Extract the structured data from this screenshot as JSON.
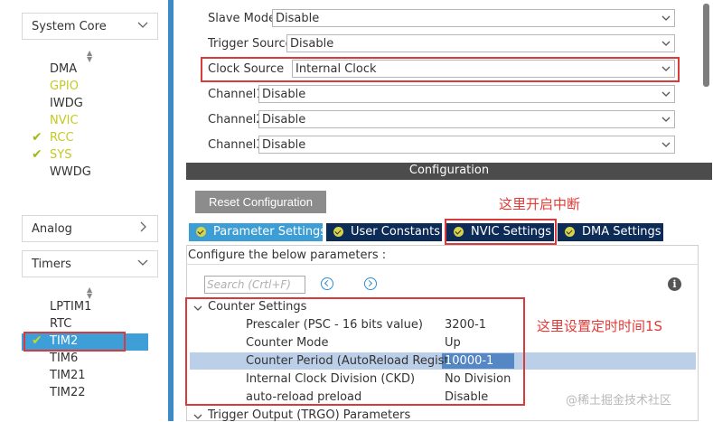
{
  "sidebar": {
    "categories": [
      {
        "label": "System Core",
        "expanded": true
      },
      {
        "label": "Analog",
        "expanded": false
      },
      {
        "label": "Timers",
        "expanded": true
      }
    ],
    "system_core_items": [
      {
        "label": "DMA",
        "state": "normal",
        "checked": false
      },
      {
        "label": "GPIO",
        "state": "yellow",
        "checked": false
      },
      {
        "label": "IWDG",
        "state": "normal",
        "checked": false
      },
      {
        "label": "NVIC",
        "state": "yellow",
        "checked": false
      },
      {
        "label": "RCC",
        "state": "yellow",
        "checked": true
      },
      {
        "label": "SYS",
        "state": "yellow",
        "checked": true
      },
      {
        "label": "WWDG",
        "state": "normal",
        "checked": false
      }
    ],
    "timer_items": [
      {
        "label": "LPTIM1",
        "selected": false
      },
      {
        "label": "RTC",
        "selected": false
      },
      {
        "label": "TIM2",
        "selected": true,
        "checked": true
      },
      {
        "label": "TIM6",
        "selected": false
      },
      {
        "label": "TIM21",
        "selected": false
      },
      {
        "label": "TIM22",
        "selected": false
      }
    ]
  },
  "mode": {
    "rows": [
      {
        "label": "Slave Mode",
        "value": "Disable"
      },
      {
        "label": "Trigger Source",
        "value": "Disable"
      },
      {
        "label": "Clock Source",
        "value": "Internal Clock"
      },
      {
        "label": "Channel1",
        "value": "Disable"
      },
      {
        "label": "Channel2",
        "value": "Disable"
      },
      {
        "label": "Channel3",
        "value": "Disable"
      }
    ]
  },
  "config": {
    "title": "Configuration",
    "reset_label": "Reset Configuration",
    "tabs": [
      {
        "label": "Parameter Settings",
        "active": true
      },
      {
        "label": "User Constants",
        "active": false
      },
      {
        "label": "NVIC Settings",
        "active": false
      },
      {
        "label": "DMA Settings",
        "active": false
      }
    ],
    "instructions": "Configure the below parameters :",
    "search_placeholder": "Search (Crtl+F)",
    "counter_settings": {
      "title": "Counter Settings",
      "params": [
        {
          "label": "Prescaler (PSC - 16 bits value)",
          "value": "3200-1"
        },
        {
          "label": "Counter Mode",
          "value": "Up"
        },
        {
          "label": "Counter Period (AutoReload Regist...",
          "value": "10000-1"
        },
        {
          "label": "Internal Clock Division (CKD)",
          "value": "No Division"
        },
        {
          "label": "auto-reload preload",
          "value": "Disable"
        }
      ]
    },
    "trgo_title": "Trigger Output (TRGO) Parameters"
  },
  "annotations": {
    "nvic_note": "这里开启中断",
    "timer_note": "这里设置定时时间1S"
  },
  "watermark": "@稀土掘金技术社区",
  "colors": {
    "highlight_red": "#d83b3b",
    "tab_active": "#3d9dd5",
    "tab_inactive": "#0c2b57",
    "sidebar_divider": "#3c8ac6",
    "yellow_item": "#c4c924"
  }
}
